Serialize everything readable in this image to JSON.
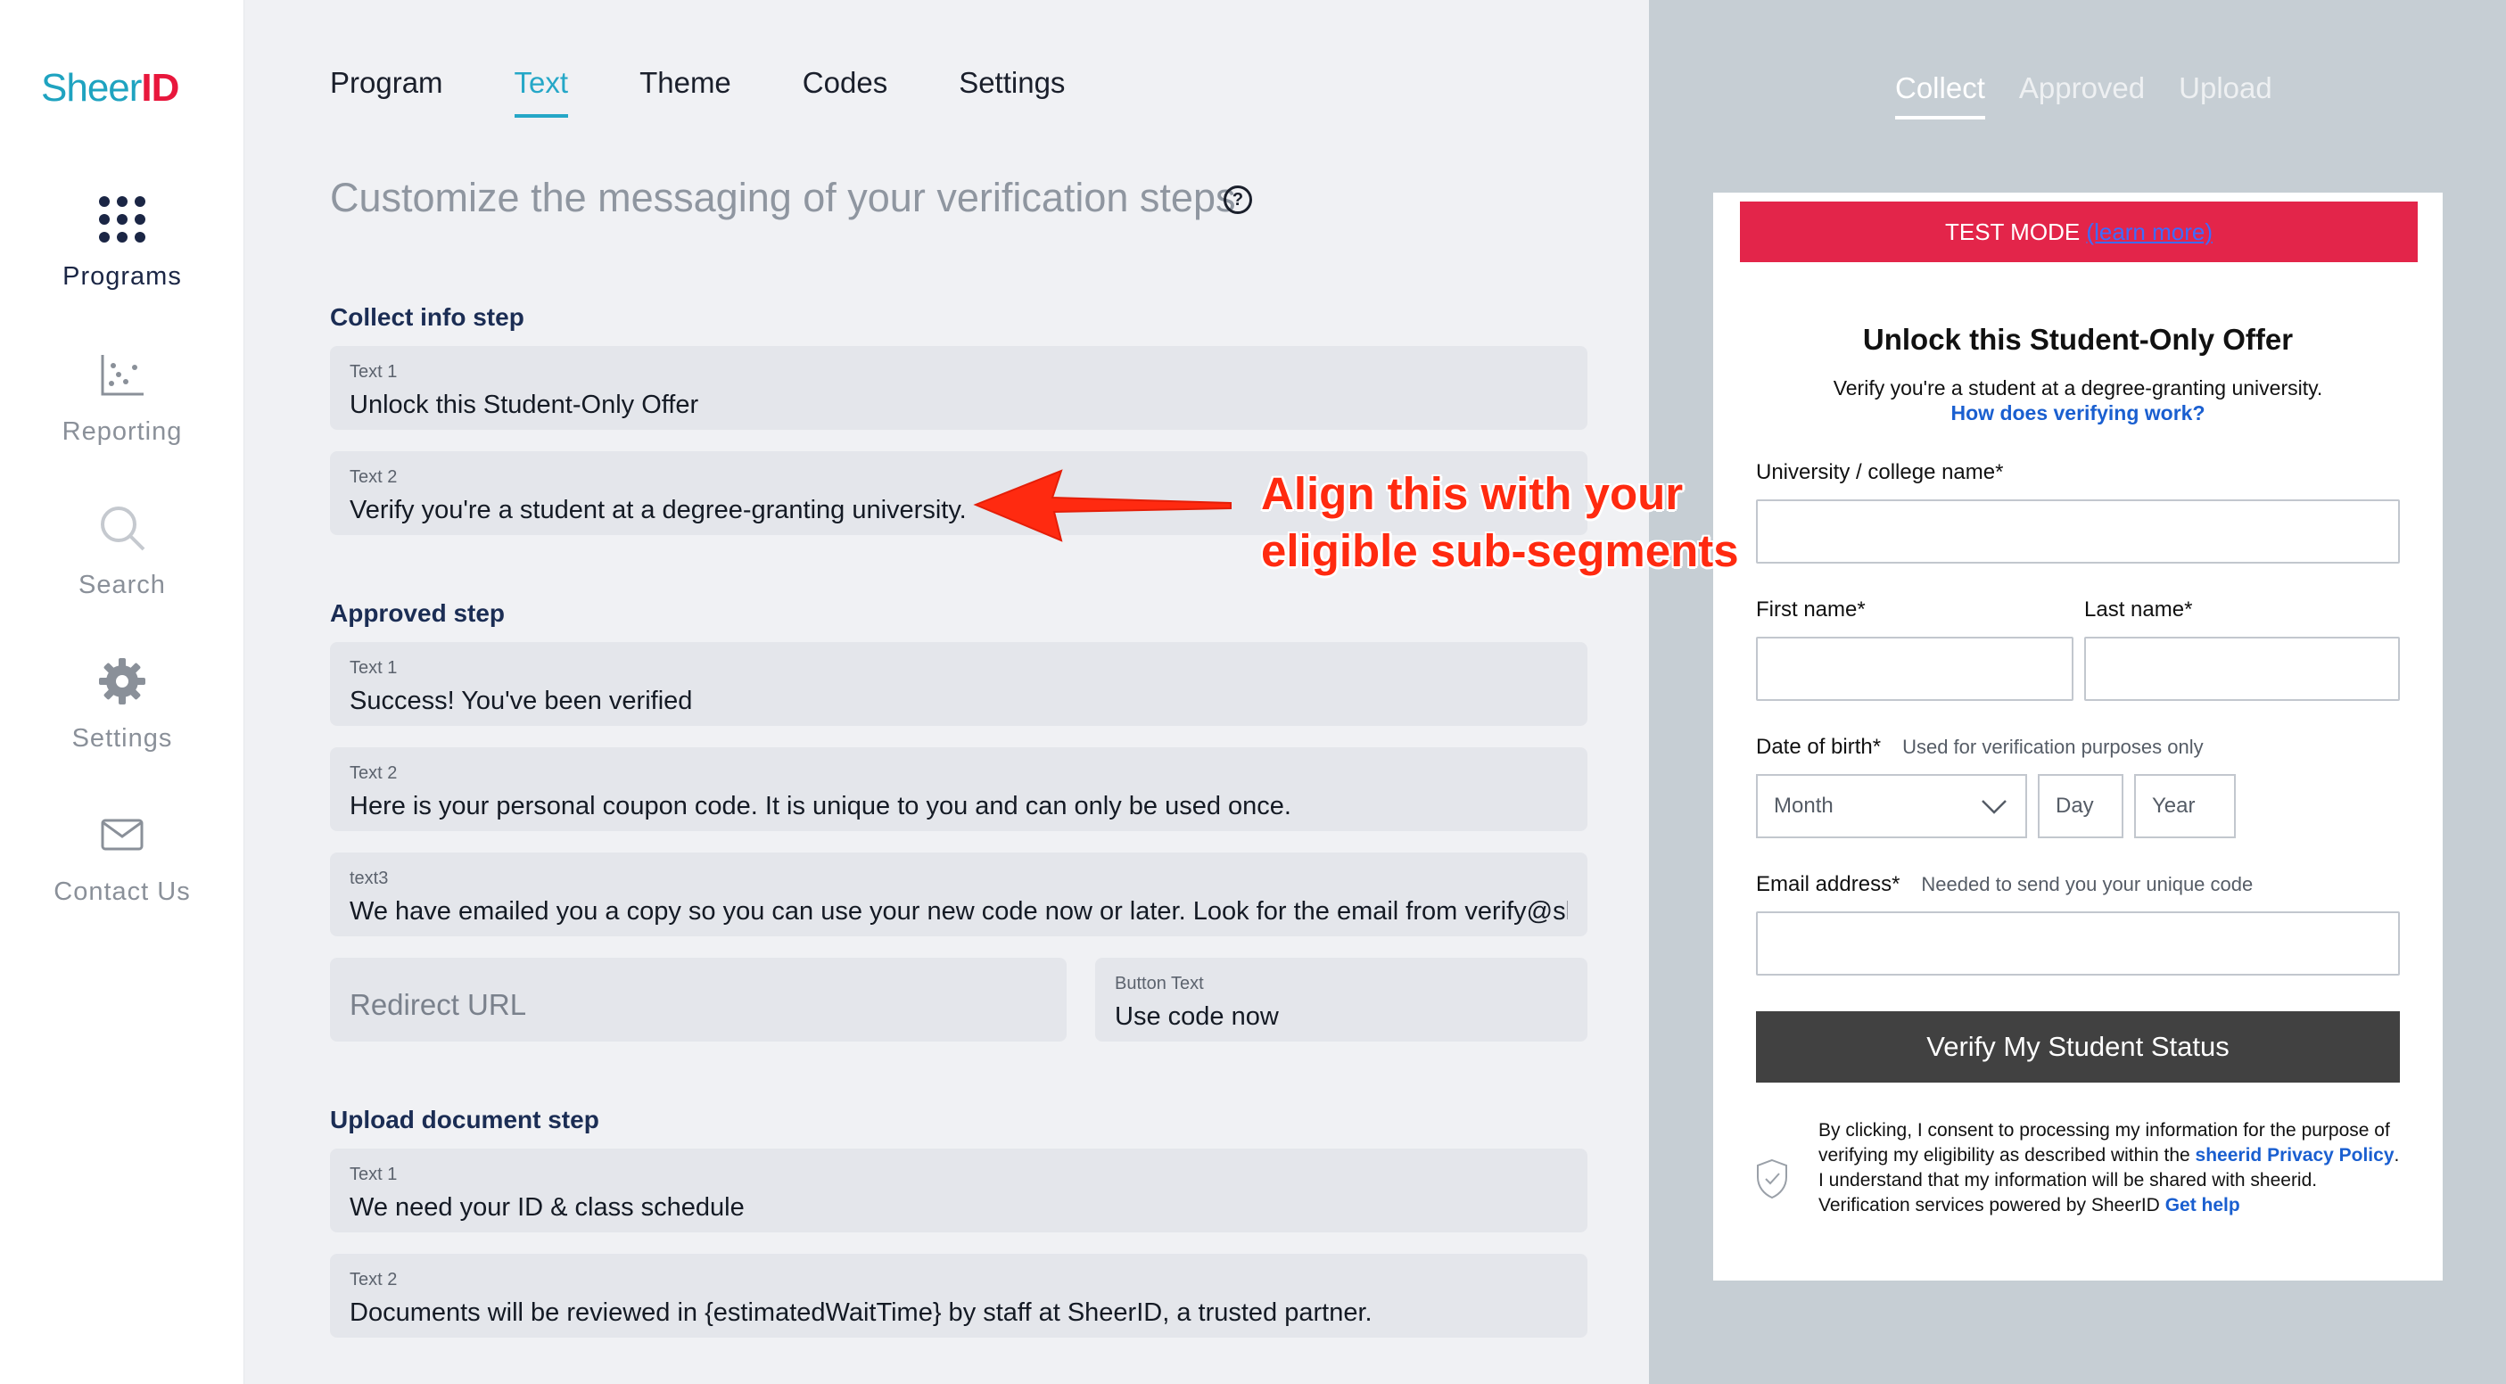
{
  "logo": {
    "main": "Sheer",
    "accent": "ID"
  },
  "sidebar": {
    "items": [
      {
        "label": "Programs",
        "icon": "grid-dots-icon",
        "active": true
      },
      {
        "label": "Reporting",
        "icon": "scatter-chart-icon",
        "active": false
      },
      {
        "label": "Search",
        "icon": "search-icon",
        "active": false
      },
      {
        "label": "Settings",
        "icon": "gear-icon",
        "active": false
      },
      {
        "label": "Contact Us",
        "icon": "envelope-icon",
        "active": false
      }
    ]
  },
  "tabs": [
    {
      "label": "Program",
      "active": false
    },
    {
      "label": "Text",
      "active": true
    },
    {
      "label": "Theme",
      "active": false
    },
    {
      "label": "Codes",
      "active": false
    },
    {
      "label": "Settings",
      "active": false
    }
  ],
  "page_title": "Customize the messaging of your verification steps",
  "help_icon_glyph": "?",
  "collect_step": {
    "title": "Collect info step",
    "text1": {
      "label": "Text 1",
      "value": "Unlock this Student-Only Offer"
    },
    "text2": {
      "label": "Text 2",
      "value": "Verify you're a student at a degree-granting university."
    }
  },
  "approved_step": {
    "title": "Approved step",
    "text1": {
      "label": "Text 1",
      "value": "Success! You've been verified"
    },
    "text2": {
      "label": "Text 2",
      "value": "Here is your personal coupon code. It is unique to you and can only be used once."
    },
    "text3": {
      "label": "text3",
      "value": "We have emailed you a copy so you can use your new code now or later. Look for the email from verify@sheerid.com"
    },
    "redirect_placeholder": "Redirect URL",
    "button_text": {
      "label": "Button Text",
      "value": "Use code now"
    }
  },
  "upload_step": {
    "title": "Upload document step",
    "text1": {
      "label": "Text 1",
      "value": "We need your ID & class schedule"
    },
    "text2": {
      "label": "Text 2",
      "value": "Documents will be reviewed in {estimatedWaitTime} by staff at SheerID, a trusted partner."
    }
  },
  "annotation": {
    "line1": "Align this with your",
    "line2": "eligible sub-segments",
    "color": "#ff2a10"
  },
  "preview": {
    "tabs": [
      {
        "label": "Collect",
        "active": true
      },
      {
        "label": "Approved",
        "active": false
      },
      {
        "label": "Upload",
        "active": false
      }
    ],
    "test_mode": "TEST MODE",
    "learn_more": "(learn more)",
    "title": "Unlock this Student-Only Offer",
    "subtitle": "Verify you're a student at a degree-granting university.",
    "how_link": "How does verifying work?",
    "university_label": "University / college name*",
    "first_name_label": "First name*",
    "last_name_label": "Last name*",
    "dob_label": "Date of birth*",
    "dob_hint": "Used for verification purposes only",
    "month": "Month",
    "day": "Day",
    "year": "Year",
    "email_label": "Email address*",
    "email_hint": "Needed to send you your unique code",
    "verify_button": "Verify My Student Status",
    "consent_1": "By clicking, I consent to processing my information for the purpose of verifying my eligibility as described within the",
    "consent_link1": "sheerid Privacy Policy",
    "consent_2": ". I understand that my information will be shared with sheerid.",
    "consent_3": "Verification services powered by SheerID",
    "consent_link2": "Get help"
  },
  "colors": {
    "brand_teal": "#25a7c7",
    "brand_red": "#e8173c",
    "navy": "#1b2d54",
    "test_bar": "#e3254a",
    "button_dark": "#414141"
  }
}
